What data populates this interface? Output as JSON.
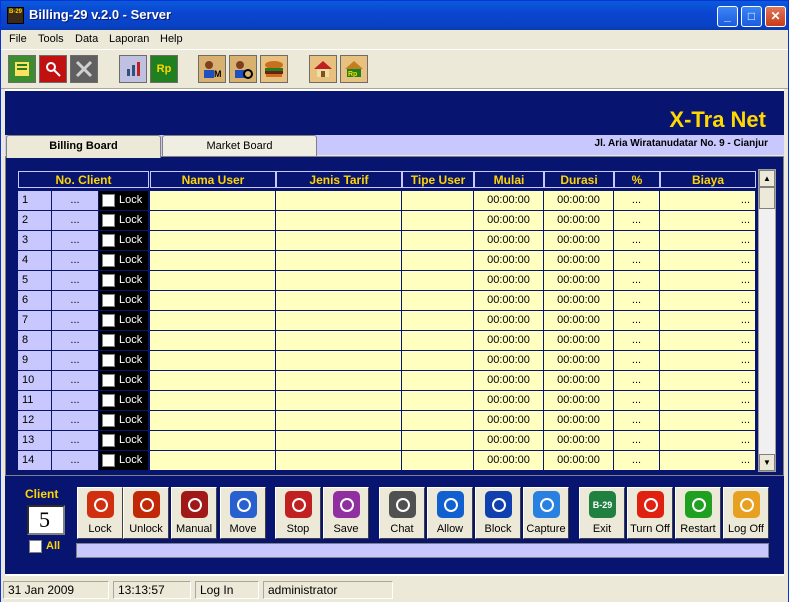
{
  "window": {
    "title": "Billing-29 v.2.0 - Server",
    "icon_text": "B-29"
  },
  "menu": [
    "File",
    "Tools",
    "Data",
    "Laporan",
    "Help"
  ],
  "toolbar": {
    "icons": [
      "book-icon",
      "key-icon",
      "x-tool-icon",
      "tools-icon",
      "rupiah-icon",
      "member-icon",
      "operator-icon",
      "food-icon",
      "home-icon",
      "rupiah-price-icon"
    ],
    "rp_label": "Rp"
  },
  "banner": {
    "brand": "X-Tra Net",
    "address": "Jl. Aria Wiratanudatar No. 9 - Cianjur"
  },
  "tabs": [
    "Billing Board",
    "Market Board"
  ],
  "grid": {
    "headers": [
      "No. Client",
      "Nama User",
      "Jenis Tarif",
      "Tipe User",
      "Mulai",
      "Durasi",
      "%",
      "Biaya"
    ],
    "lock_label": "Lock",
    "rows": [
      {
        "num": "1",
        "dots": "...",
        "mulai": "00:00:00",
        "durasi": "00:00:00",
        "pct": "...",
        "biaya": "..."
      },
      {
        "num": "2",
        "dots": "...",
        "mulai": "00:00:00",
        "durasi": "00:00:00",
        "pct": "...",
        "biaya": "..."
      },
      {
        "num": "3",
        "dots": "...",
        "mulai": "00:00:00",
        "durasi": "00:00:00",
        "pct": "...",
        "biaya": "..."
      },
      {
        "num": "4",
        "dots": "...",
        "mulai": "00:00:00",
        "durasi": "00:00:00",
        "pct": "...",
        "biaya": "..."
      },
      {
        "num": "5",
        "dots": "...",
        "mulai": "00:00:00",
        "durasi": "00:00:00",
        "pct": "...",
        "biaya": "..."
      },
      {
        "num": "6",
        "dots": "...",
        "mulai": "00:00:00",
        "durasi": "00:00:00",
        "pct": "...",
        "biaya": "..."
      },
      {
        "num": "7",
        "dots": "...",
        "mulai": "00:00:00",
        "durasi": "00:00:00",
        "pct": "...",
        "biaya": "..."
      },
      {
        "num": "8",
        "dots": "...",
        "mulai": "00:00:00",
        "durasi": "00:00:00",
        "pct": "...",
        "biaya": "..."
      },
      {
        "num": "9",
        "dots": "...",
        "mulai": "00:00:00",
        "durasi": "00:00:00",
        "pct": "...",
        "biaya": "..."
      },
      {
        "num": "10",
        "dots": "...",
        "mulai": "00:00:00",
        "durasi": "00:00:00",
        "pct": "...",
        "biaya": "..."
      },
      {
        "num": "11",
        "dots": "...",
        "mulai": "00:00:00",
        "durasi": "00:00:00",
        "pct": "...",
        "biaya": "..."
      },
      {
        "num": "12",
        "dots": "...",
        "mulai": "00:00:00",
        "durasi": "00:00:00",
        "pct": "...",
        "biaya": "..."
      },
      {
        "num": "13",
        "dots": "...",
        "mulai": "00:00:00",
        "durasi": "00:00:00",
        "pct": "...",
        "biaya": "..."
      },
      {
        "num": "14",
        "dots": "...",
        "mulai": "00:00:00",
        "durasi": "00:00:00",
        "pct": "...",
        "biaya": "..."
      }
    ]
  },
  "controls": {
    "client_label": "Client",
    "client_value": "5",
    "all_label": "All",
    "buttons": [
      {
        "label": "Lock",
        "icon": "lock-icon",
        "color": "#d03010"
      },
      {
        "label": "Unlock",
        "icon": "unlock-icon",
        "color": "#c02808"
      },
      {
        "label": "Manual",
        "icon": "manual-run-icon",
        "color": "#a01818"
      },
      {
        "label": "Move",
        "icon": "move-icon",
        "color": "#2860d0"
      },
      {
        "label": "Stop",
        "icon": "stop-icon",
        "color": "#c02020"
      },
      {
        "label": "Save",
        "icon": "save-icon",
        "color": "#9030a0"
      },
      {
        "label": "Chat",
        "icon": "chat-icon",
        "color": "#505050"
      },
      {
        "label": "Allow",
        "icon": "allow-ie-icon",
        "color": "#1060d0"
      },
      {
        "label": "Block",
        "icon": "block-ie-icon",
        "color": "#1040b0"
      },
      {
        "label": "Capture",
        "icon": "capture-icon",
        "color": "#2880e0"
      },
      {
        "label": "Exit",
        "icon": "exit-icon",
        "color": "#208040",
        "glyph": "B-29"
      },
      {
        "label": "Turn Off",
        "icon": "power-icon",
        "color": "#e02010"
      },
      {
        "label": "Restart",
        "icon": "restart-icon",
        "color": "#20a020"
      },
      {
        "label": "Log Off",
        "icon": "logoff-icon",
        "color": "#e8a020"
      }
    ]
  },
  "status": {
    "date": "31 Jan 2009",
    "time": "13:13:57",
    "event": "Log In",
    "user": "administrator"
  }
}
